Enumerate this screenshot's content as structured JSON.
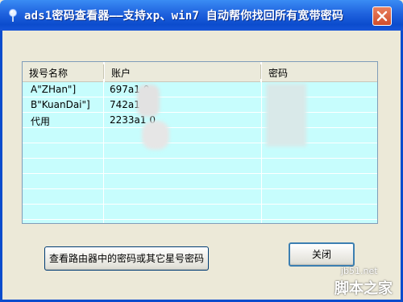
{
  "window": {
    "title": "ads1密码查看器——支持xp、win7 自动帮你找回所有宽带密码"
  },
  "table": {
    "columns": [
      "拨号名称",
      "账户",
      "密码"
    ],
    "rows": [
      {
        "name": "A\"ZHan\"]",
        "account": "697a1   0",
        "password": ""
      },
      {
        "name": "B\"KuanDai\"]",
        "account": "742a1   0",
        "password": ""
      },
      {
        "name": "代用",
        "account": "2233a1   0",
        "password": ""
      }
    ]
  },
  "buttons": {
    "find_label": "查看路由器中的密码或其它星号密码",
    "close_label": "关闭"
  },
  "watermark": {
    "url": "jb51.net",
    "name": "脚本之家"
  },
  "colors": {
    "titlebar": "#0b4ccd",
    "row_bg": "#c7fdfd",
    "window_bg": "#ece9d8"
  },
  "icons": [
    "pin-icon",
    "close-icon"
  ]
}
